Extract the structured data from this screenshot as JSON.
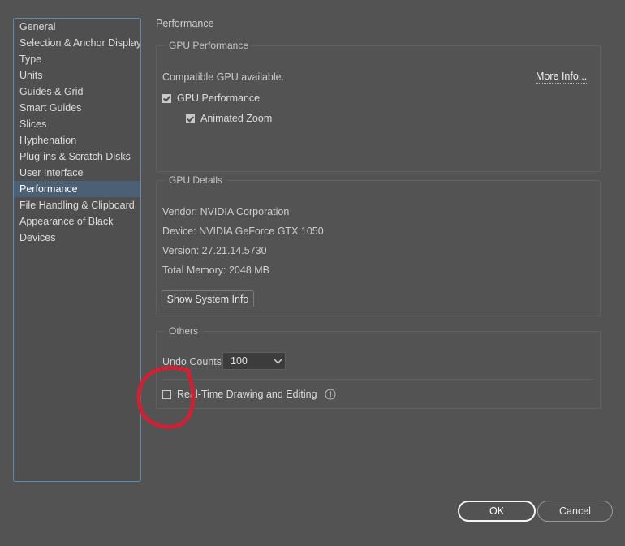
{
  "pane": {
    "title": "Performance"
  },
  "sidebar": {
    "items": [
      {
        "label": "General",
        "selected": false
      },
      {
        "label": "Selection & Anchor Display",
        "selected": false
      },
      {
        "label": "Type",
        "selected": false
      },
      {
        "label": "Units",
        "selected": false
      },
      {
        "label": "Guides & Grid",
        "selected": false
      },
      {
        "label": "Smart Guides",
        "selected": false
      },
      {
        "label": "Slices",
        "selected": false
      },
      {
        "label": "Hyphenation",
        "selected": false
      },
      {
        "label": "Plug-ins & Scratch Disks",
        "selected": false
      },
      {
        "label": "User Interface",
        "selected": false
      },
      {
        "label": "Performance",
        "selected": true
      },
      {
        "label": "File Handling & Clipboard",
        "selected": false
      },
      {
        "label": "Appearance of Black",
        "selected": false
      },
      {
        "label": "Devices",
        "selected": false
      }
    ]
  },
  "gpu_performance": {
    "group_label": "GPU Performance",
    "status_text": "Compatible GPU available.",
    "more_info_label": "More Info...",
    "checkbox_gpu_performance": {
      "label": "GPU Performance",
      "checked": true
    },
    "checkbox_animated_zoom": {
      "label": "Animated Zoom",
      "checked": true
    }
  },
  "gpu_details": {
    "group_label": "GPU Details",
    "vendor": "Vendor: NVIDIA Corporation",
    "device": "Device: NVIDIA GeForce GTX 1050",
    "version": "Version: 27.21.14.5730",
    "total_memory": "Total Memory: 2048 MB",
    "show_system_info_label": "Show System Info"
  },
  "others": {
    "group_label": "Others",
    "undo_counts_label": "Undo Counts:",
    "undo_counts_value": "100",
    "undo_counts_options": [
      "100"
    ],
    "checkbox_realtime": {
      "label": "Real-Time Drawing and Editing",
      "checked": false
    },
    "info_icon_name": "info-icon"
  },
  "footer": {
    "ok_label": "OK",
    "cancel_label": "Cancel"
  },
  "annotation": {
    "shape": "hand-drawn-ellipse",
    "color": "#cc2236",
    "target": "Real-Time Drawing and Editing checkbox"
  },
  "colors": {
    "window_bg": "#535353",
    "sidebar_bg": "#4f4f4f",
    "sidebar_focus_border": "#5b8cb3",
    "selection_bg": "#4c6075",
    "group_border": "#606060",
    "text": "#d0d0d0",
    "annotation_red": "#cc2236"
  }
}
